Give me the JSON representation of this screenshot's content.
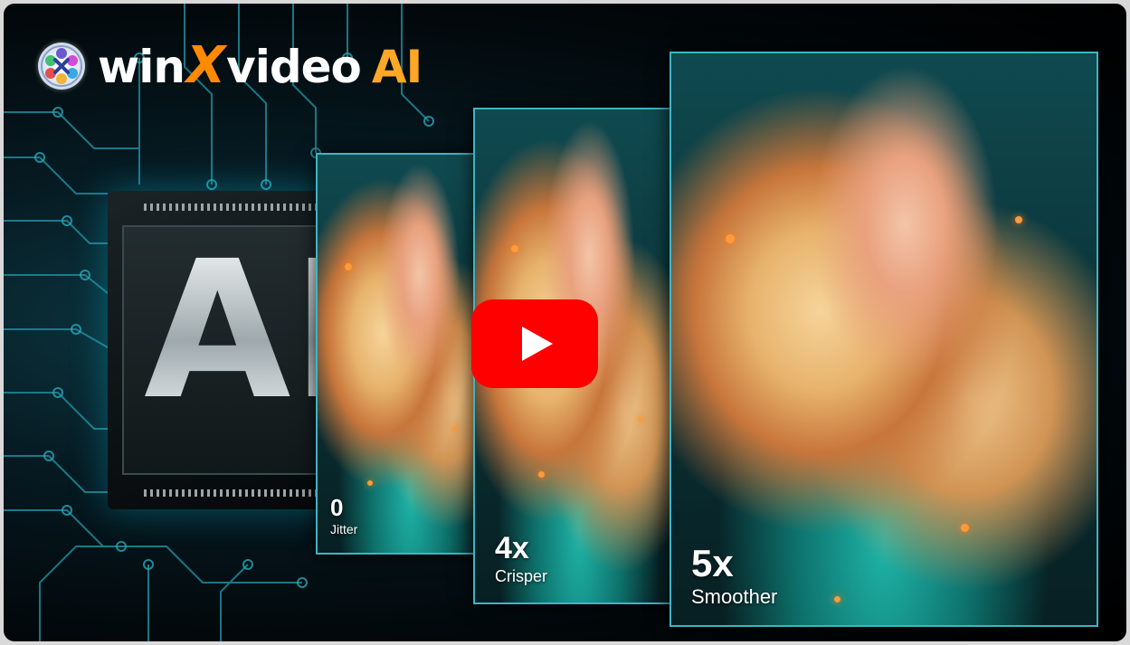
{
  "brand": {
    "name_part1": "win",
    "name_x": "X",
    "name_part2": "video",
    "name_ai": "AI",
    "accent_color": "#ff8a00",
    "icon": "film-reel-icon"
  },
  "chip": {
    "label": "AI"
  },
  "cards": [
    {
      "value": "0",
      "caption": "Jitter"
    },
    {
      "value": "4x",
      "caption": "Crisper"
    },
    {
      "value": "5x",
      "caption": "Smoother"
    }
  ],
  "video": {
    "play_icon": "play-icon",
    "play_color": "#ff0000"
  }
}
